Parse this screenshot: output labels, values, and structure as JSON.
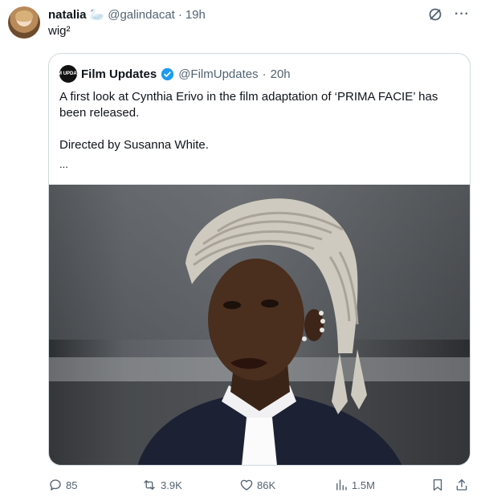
{
  "tweet": {
    "author_name": "natalia",
    "author_emoji": "🦢",
    "author_handle": "@galindacat",
    "separator": "·",
    "time": "19h",
    "text": "wig²"
  },
  "quoted": {
    "author_name": "Film Updates",
    "avatar_text": "FILM UPDATES",
    "author_handle": "@FilmUpdates",
    "separator": "·",
    "time": "20h",
    "text_line1": "A first look at Cynthia Erivo in the film adaptation of ‘PRIMA FACIE’ has been released.",
    "text_line2": "Directed by Susanna White.",
    "ellipsis": "..."
  },
  "actions": {
    "replies": "85",
    "reposts": "3.9K",
    "likes": "86K",
    "views": "1.5M"
  },
  "icons": {
    "top": [
      "grok-icon",
      "more-icon"
    ],
    "bar": [
      "reply-icon",
      "repost-icon",
      "like-icon",
      "views-icon",
      "bookmark-icon",
      "share-icon"
    ]
  },
  "colors": {
    "text": "#0f1419",
    "muted": "#536471",
    "border": "#cfd9de",
    "verified": "#1d9bf0"
  }
}
